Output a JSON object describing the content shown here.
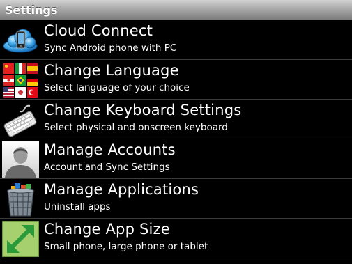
{
  "header": {
    "title": "Settings"
  },
  "items": [
    {
      "title": "Cloud Connect",
      "subtitle": "Sync Android phone with PC",
      "icon": "cloud-phone-icon"
    },
    {
      "title": "Change Language",
      "subtitle": "Select language of your choice",
      "icon": "flags-icon"
    },
    {
      "title": "Change Keyboard Settings",
      "subtitle": "Select physical and onscreen keyboard",
      "icon": "keyboard-icon"
    },
    {
      "title": "Manage Accounts",
      "subtitle": "Account and Sync Settings",
      "icon": "user-avatar-icon"
    },
    {
      "title": "Manage Applications",
      "subtitle": "Uninstall apps",
      "icon": "trash-bin-icon"
    },
    {
      "title": "Change App Size",
      "subtitle": "Small phone, large phone or tablet",
      "icon": "resize-arrow-icon"
    }
  ],
  "colors": {
    "background": "#000000",
    "text": "#ffffff",
    "titlebar_top": "#d2d2d2",
    "titlebar_bottom": "#7c7c7c",
    "resize_icon_bg": "#a6cf6e",
    "resize_arrow": "#2a9a3a"
  }
}
